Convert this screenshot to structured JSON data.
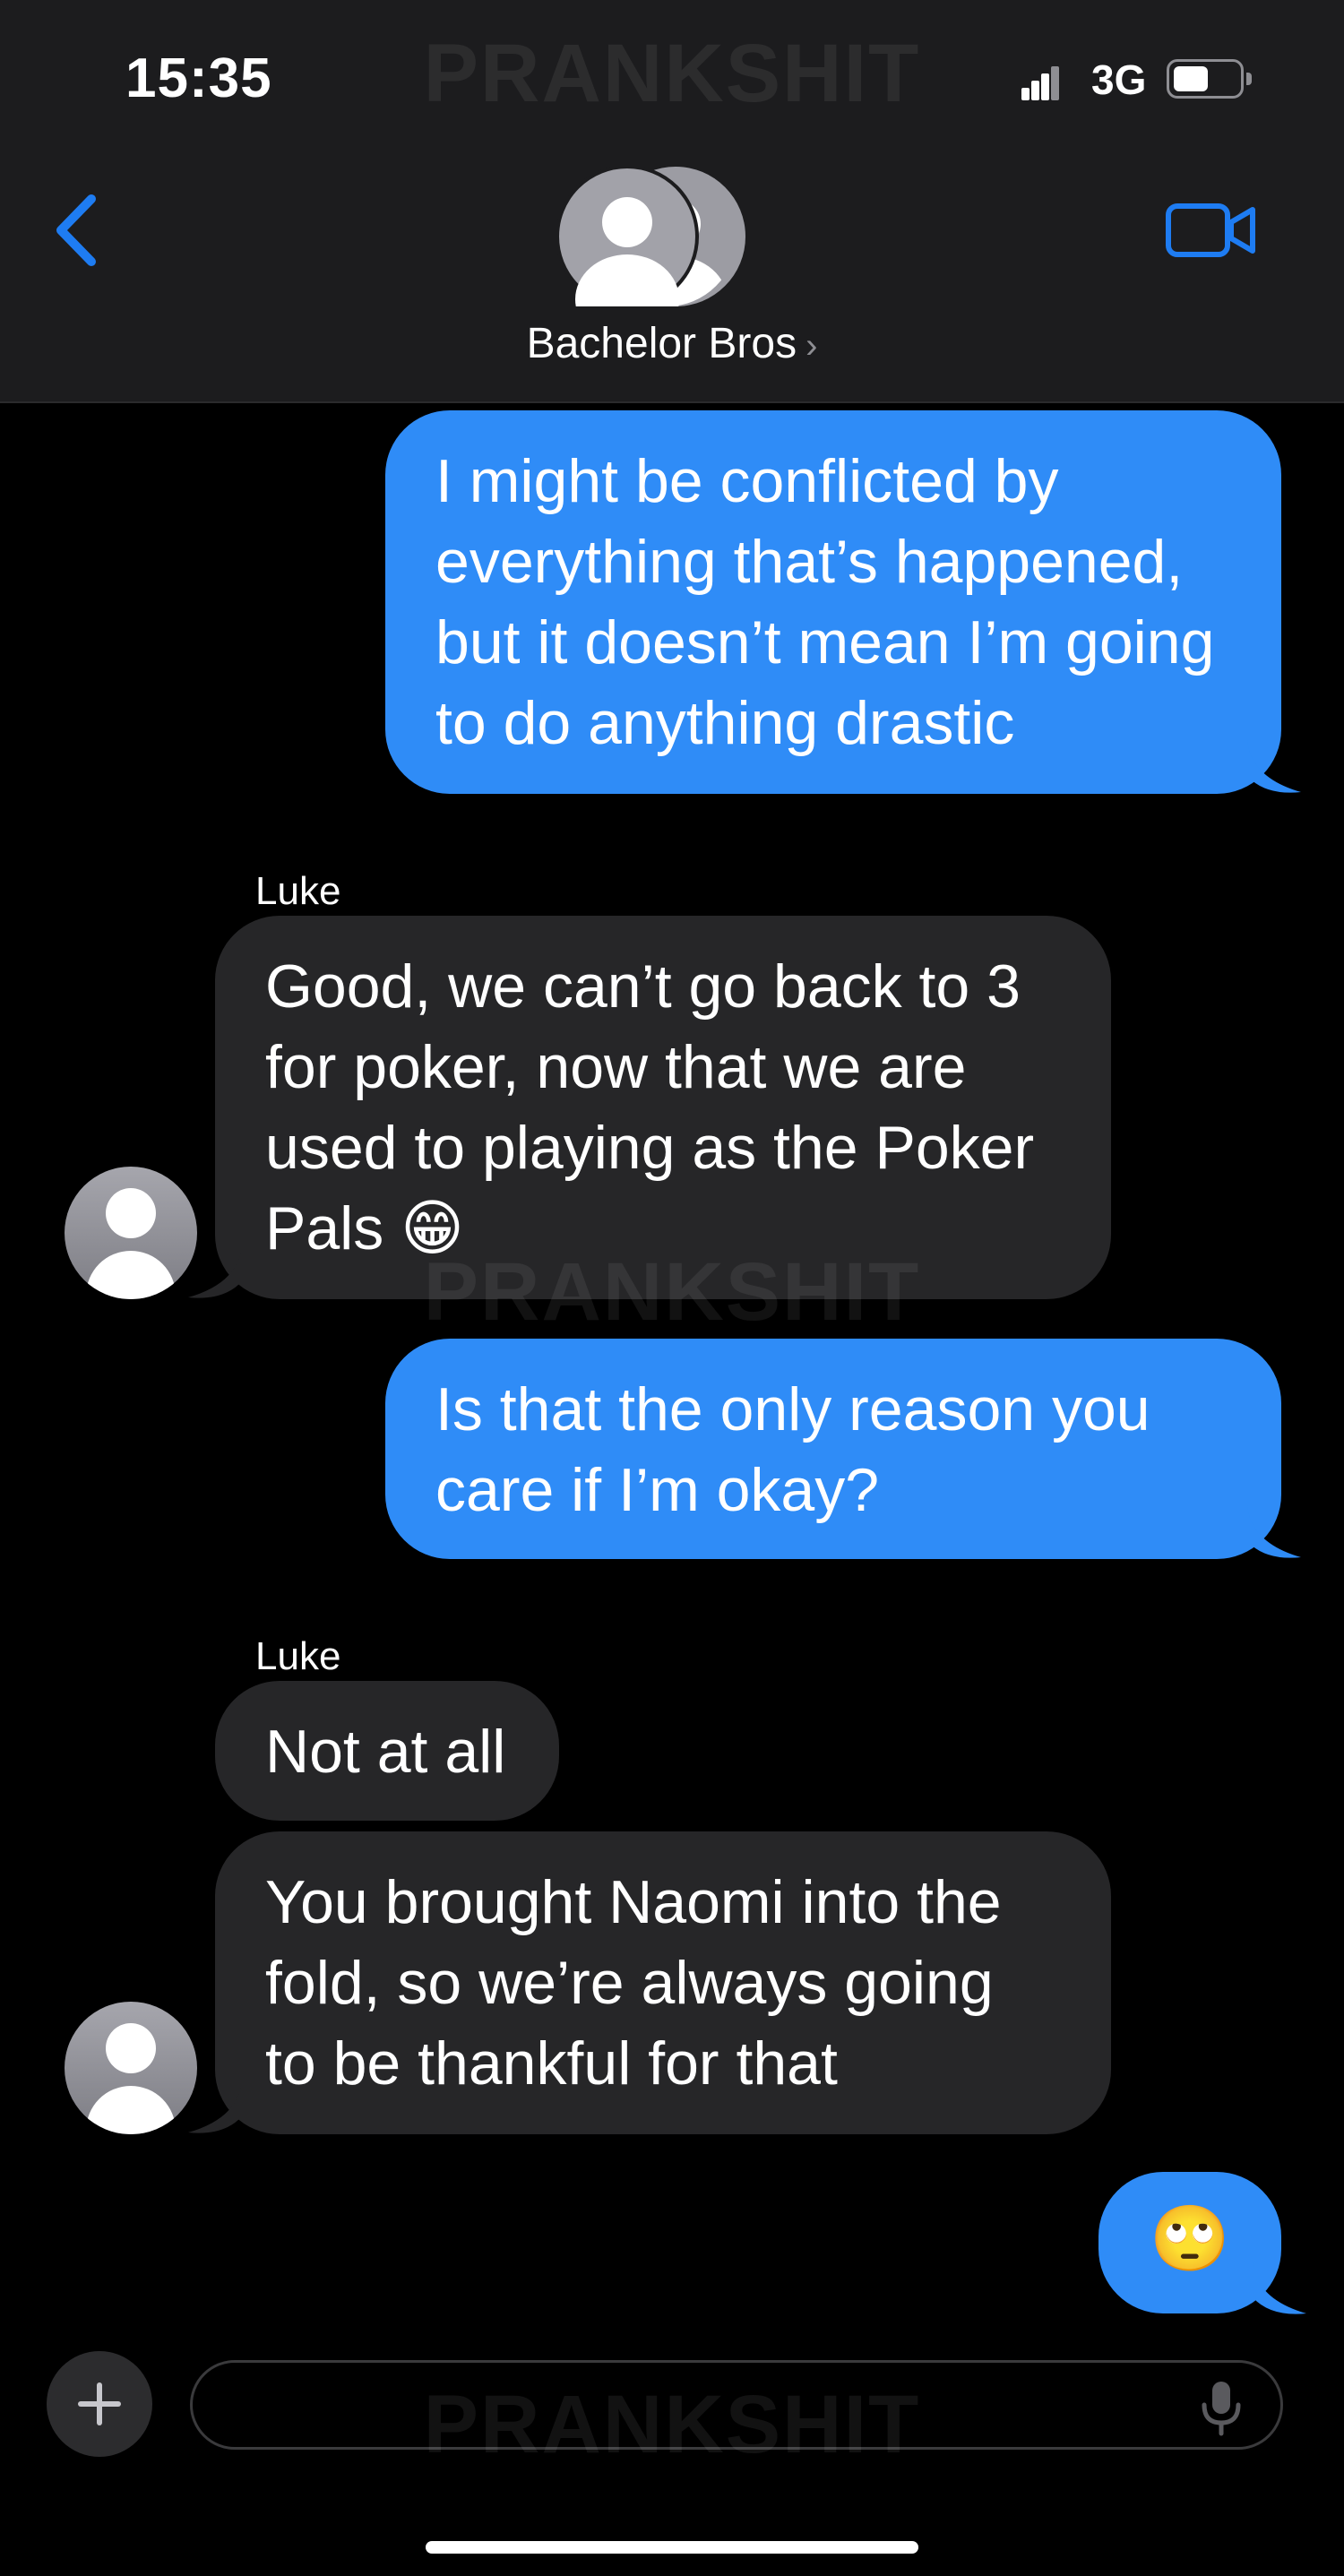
{
  "status_bar": {
    "time": "15:35",
    "network": "3G"
  },
  "watermark": "PRANKSHIT",
  "header": {
    "group_name": "Bachelor Bros",
    "chevron": "›"
  },
  "messages": [
    {
      "id": "m1",
      "direction": "sent",
      "text": "I might be conflicted by everything that’s happened, but it doesn’t mean I’m going to do anything drastic"
    },
    {
      "id": "m2",
      "direction": "received",
      "sender": "Luke",
      "text": "Good, we can’t go back to 3 for poker, now that we are used to playing as the Poker Pals 😁"
    },
    {
      "id": "m3",
      "direction": "sent",
      "text": "Is that the only reason you care if I’m okay?"
    },
    {
      "id": "m4",
      "direction": "received",
      "sender": "Luke",
      "text": "Not at all"
    },
    {
      "id": "m5",
      "direction": "received",
      "text": "You brought Naomi into the fold, so we’re always going to be thankful for that"
    },
    {
      "id": "m6",
      "direction": "sent",
      "text": "🙄"
    }
  ],
  "input": {
    "placeholder": ""
  },
  "colors": {
    "sent_bubble": "#2f8cf7",
    "received_bubble": "#262628",
    "accent": "#1e7cf2",
    "header_bg": "#1c1c1e"
  },
  "icons": [
    "back-chevron-icon",
    "video-camera-icon",
    "group-avatar-icon",
    "contact-avatar-icon",
    "plus-icon",
    "microphone-icon"
  ]
}
